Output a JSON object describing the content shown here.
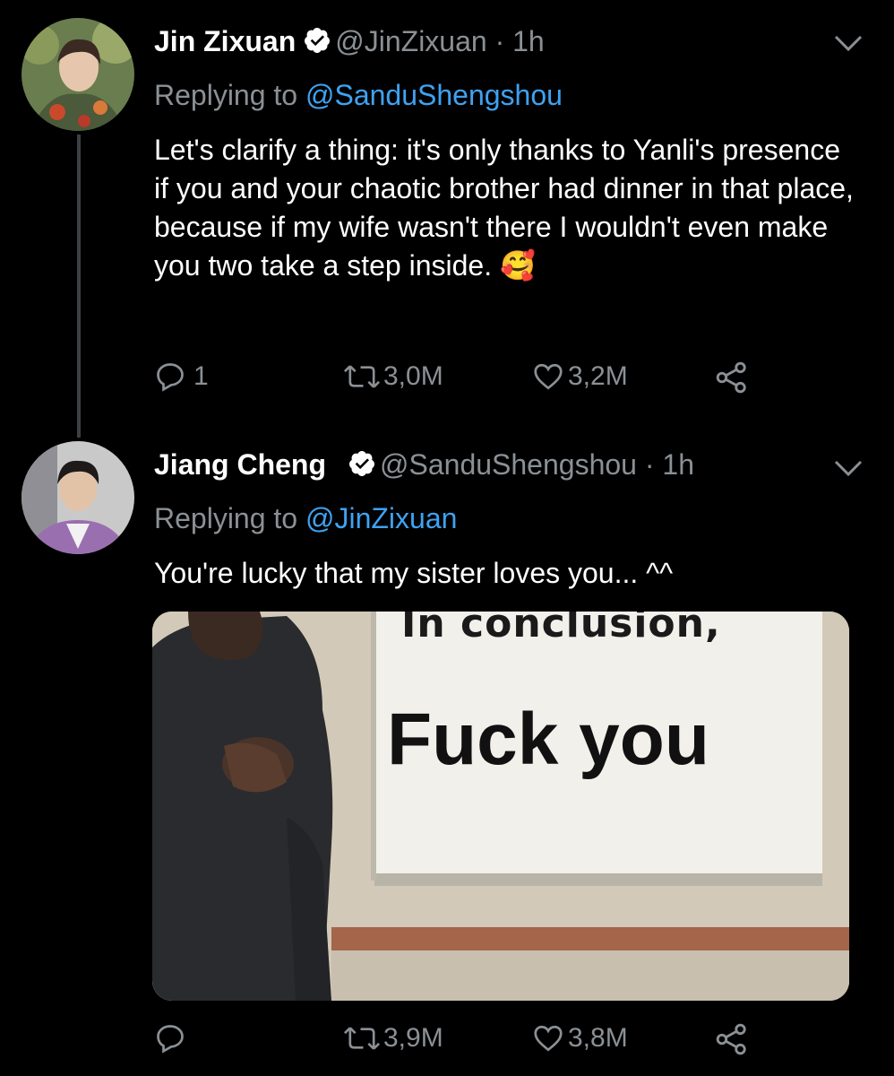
{
  "tweets": [
    {
      "name": "Jin Zixuan",
      "handle": "@JinZixuan",
      "time": "· 1h",
      "replying_prefix": "Replying to",
      "replying_to": "@SanduShengshou",
      "text": "Let's clarify a thing: it's only thanks to Yanli's presence if you and your chaotic brother had dinner in that place, because if my wife wasn't there I wouldn't even make you two take a step inside.",
      "emoji": "🥰",
      "replies": "1",
      "retweets": "3,0M",
      "likes": "3,2M"
    },
    {
      "name": "Jiang Cheng",
      "handle": "@SanduShengshou",
      "time": "· 1h",
      "replying_prefix": "Replying to",
      "replying_to": "@JinZixuan",
      "text": "You're lucky that my sister loves you... ^^",
      "media": {
        "line1": "In conclusion,",
        "line2": "Fuck you"
      },
      "replies": "",
      "retweets": "3,9M",
      "likes": "3,8M"
    }
  ],
  "icons": [
    "verified-badge-icon",
    "chevron-down-icon",
    "reply-icon",
    "retweet-icon",
    "like-icon",
    "share-icon"
  ],
  "colors": {
    "background": "#000000",
    "mention": "#3ea2f2",
    "muted": "#8b9095"
  }
}
